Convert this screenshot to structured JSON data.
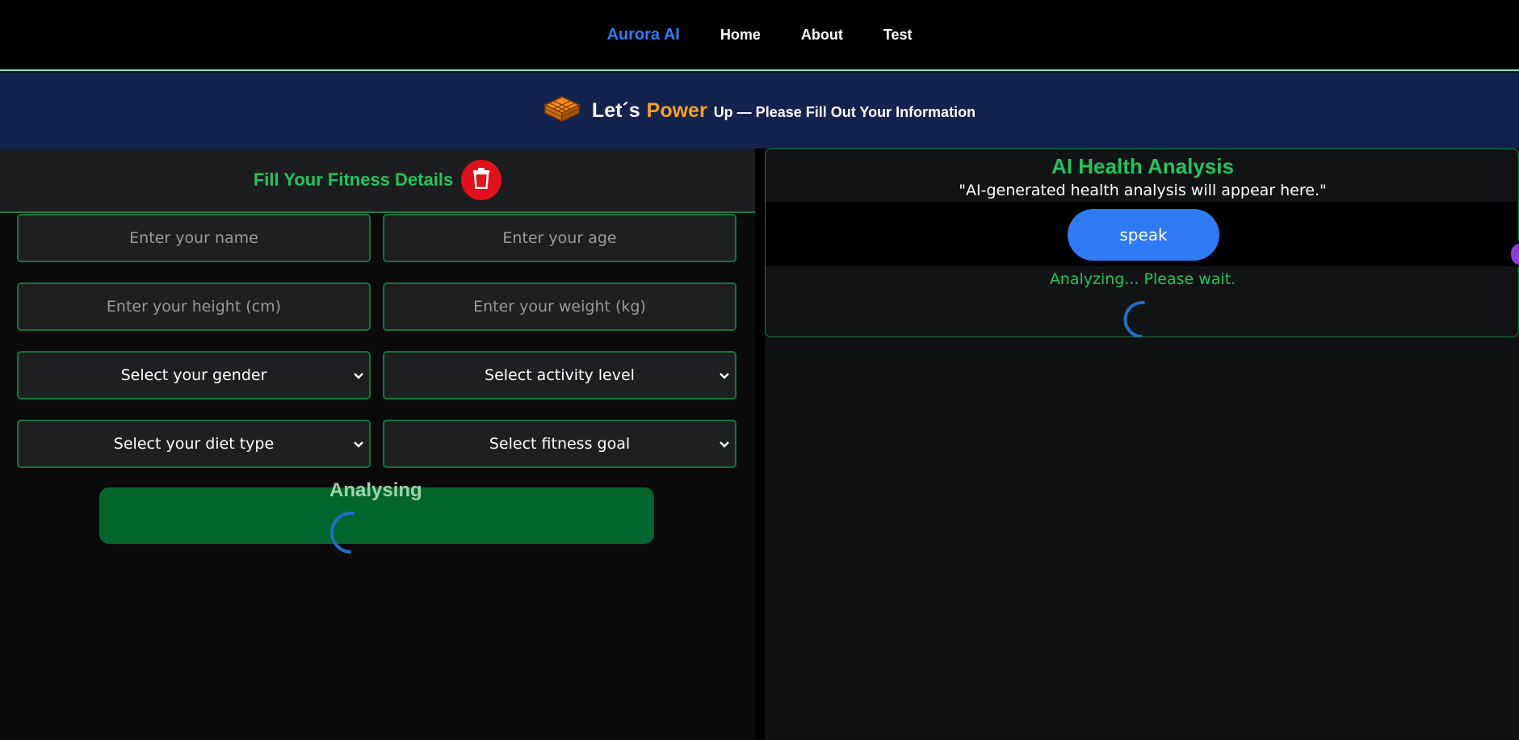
{
  "nav": {
    "brand": "Aurora AI",
    "links": [
      "Home",
      "About",
      "Test"
    ]
  },
  "banner": {
    "icon": "bricks-icon",
    "lets": "Let´s",
    "power": "Power",
    "rest": "Up — Please Fill Out Your Information"
  },
  "form": {
    "title": "Fill Your Fitness Details",
    "name_placeholder": "Enter your name",
    "age_placeholder": "Enter your age",
    "height_placeholder": "Enter your height (cm)",
    "weight_placeholder": "Enter your weight (kg)",
    "gender_select": "Select your gender",
    "activity_select": "Select activity level",
    "diet_select": "Select your diet type",
    "goal_select": "Select fitness goal",
    "submit_label": "Analysing"
  },
  "analysis": {
    "title": "AI Health Analysis",
    "placeholder": "\"AI-generated health analysis will appear here.\"",
    "speak_label": "speak",
    "status": "Analyzing... Please wait."
  },
  "colors": {
    "accent_green": "#22c55e",
    "brand_blue": "#2f7dff",
    "power_orange": "#f6a21a",
    "delete_red": "#e1101a",
    "speak_blue": "#2f7af5"
  }
}
